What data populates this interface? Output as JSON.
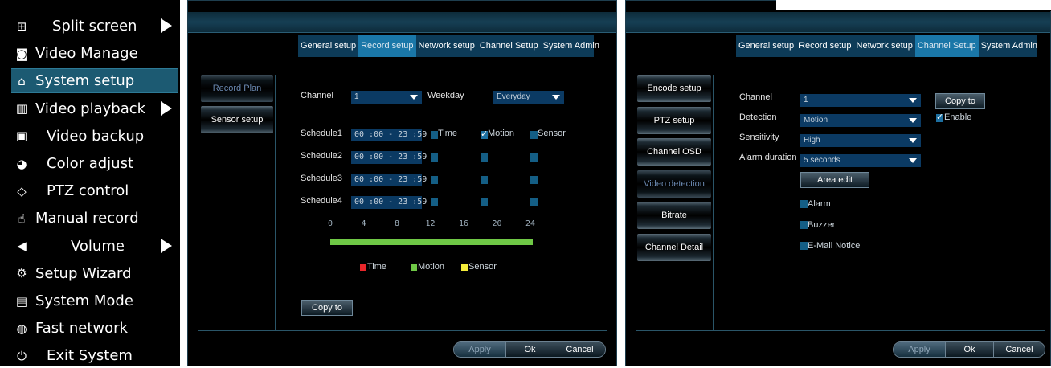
{
  "menu": {
    "items": [
      {
        "label": "Split screen",
        "icon": "grid-icon",
        "glyph": "⊞",
        "has_arrow": true
      },
      {
        "label": "Video Manage",
        "icon": "camera-icon",
        "glyph": "◙",
        "has_arrow": false
      },
      {
        "label": "System setup",
        "icon": "home-icon",
        "glyph": "⌂",
        "has_arrow": false,
        "active": true
      },
      {
        "label": "Video playback",
        "icon": "film-icon",
        "glyph": "▥",
        "has_arrow": true
      },
      {
        "label": "Video backup",
        "icon": "floppy-icon",
        "glyph": "▣",
        "has_arrow": false
      },
      {
        "label": "Color adjust",
        "icon": "palette-icon",
        "glyph": "◕",
        "has_arrow": false
      },
      {
        "label": "PTZ control",
        "icon": "diamond-icon",
        "glyph": "◇",
        "has_arrow": false
      },
      {
        "label": "Manual record",
        "icon": "hand-icon",
        "glyph": "☝",
        "has_arrow": false
      },
      {
        "label": "Volume",
        "icon": "speaker-icon",
        "glyph": "◀",
        "has_arrow": true
      },
      {
        "label": "Setup Wizard",
        "icon": "gears-icon",
        "glyph": "⚙",
        "has_arrow": false
      },
      {
        "label": "System Mode",
        "icon": "document-icon",
        "glyph": "▤",
        "has_arrow": false
      },
      {
        "label": "Fast network",
        "icon": "globe-icon",
        "glyph": "◍",
        "has_arrow": false
      },
      {
        "label": "Exit System",
        "icon": "power-icon",
        "glyph": "⏻",
        "has_arrow": false
      }
    ]
  },
  "tabs": [
    "General setup",
    "Record setup",
    "Network setup",
    "Channel Setup",
    "System Admin"
  ],
  "record": {
    "active_tab": "Record setup",
    "side": [
      "Record Plan",
      "Sensor setup"
    ],
    "channel_label": "Channel",
    "channel_value": "1",
    "weekday_label": "Weekday",
    "weekday_value": "Everyday",
    "schedules": [
      {
        "label": "Schedule1",
        "time": "00 :00 - 23 :59",
        "time_chk": false,
        "motion_chk": true,
        "sensor_chk": false
      },
      {
        "label": "Schedule2",
        "time": "00 :00 - 23 :59",
        "time_chk": false,
        "motion_chk": false,
        "sensor_chk": false
      },
      {
        "label": "Schedule3",
        "time": "00 :00 - 23 :59",
        "time_chk": false,
        "motion_chk": false,
        "sensor_chk": false
      },
      {
        "label": "Schedule4",
        "time": "00 :00 - 23 :59",
        "time_chk": false,
        "motion_chk": false,
        "sensor_chk": false
      }
    ],
    "type_labels": [
      "Time",
      "Motion",
      "Sensor"
    ],
    "ticks": [
      "0",
      "4",
      "8",
      "12",
      "16",
      "20",
      "24"
    ],
    "legend": [
      {
        "label": "Time",
        "color": "#e8262a"
      },
      {
        "label": "Motion",
        "color": "#6fc846"
      },
      {
        "label": "Sensor",
        "color": "#f4ec3a"
      }
    ],
    "timeline_color": "#6fc846",
    "copy_btn": "Copy to"
  },
  "channel": {
    "active_tab": "Channel Setup",
    "side": [
      "Encode setup",
      "PTZ setup",
      "Channel OSD",
      "Video detection",
      "Bitrate",
      "Channel Detail"
    ],
    "fields": [
      {
        "label": "Channel",
        "value": "1"
      },
      {
        "label": "Detection",
        "value": "Motion"
      },
      {
        "label": "Sensitivity",
        "value": "High"
      },
      {
        "label": "Alarm duration",
        "value": "5 seconds"
      }
    ],
    "copy_btn": "Copy to",
    "enable_label": "Enable",
    "area_btn": "Area edit",
    "options": [
      "Alarm",
      "Buzzer",
      "E-Mail Notice"
    ]
  },
  "footer": {
    "apply": "Apply",
    "ok": "Ok",
    "cancel": "Cancel"
  }
}
